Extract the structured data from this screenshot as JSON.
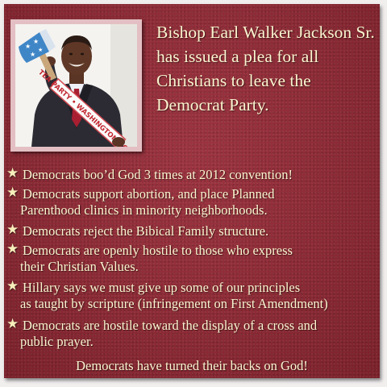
{
  "headline": [
    "Bishop Earl Walker Jackson Sr.",
    "has issued a plea for all",
    "Christians to leave the",
    "Democrat Party."
  ],
  "photo": {
    "sash_text": "TEA PARTY • WASHINGTON NOW!"
  },
  "bullets": [
    {
      "lines": [
        "Democrats boo’d God 3 times at 2012 convention!"
      ]
    },
    {
      "lines": [
        "Democrats support abortion, and place Planned",
        "Parenthood clinics in minority neighborhoods."
      ]
    },
    {
      "lines": [
        "Democrats reject the Bibical Family structure."
      ]
    },
    {
      "lines": [
        "Democrats are openly hostile to those who express",
        "their Christian Values."
      ]
    },
    {
      "lines": [
        "Hillary says we must give up some of our principles",
        "as taught by scripture (infringement on First Amendment)"
      ]
    },
    {
      "lines": [
        "Democrats are hostile toward the display of a cross and",
        "public prayer."
      ]
    }
  ],
  "footer": "Democrats have turned their backs on God!",
  "colors": {
    "background": "#8e2c37",
    "text": "#fbf5cf",
    "frame": "#e3bfc3"
  }
}
